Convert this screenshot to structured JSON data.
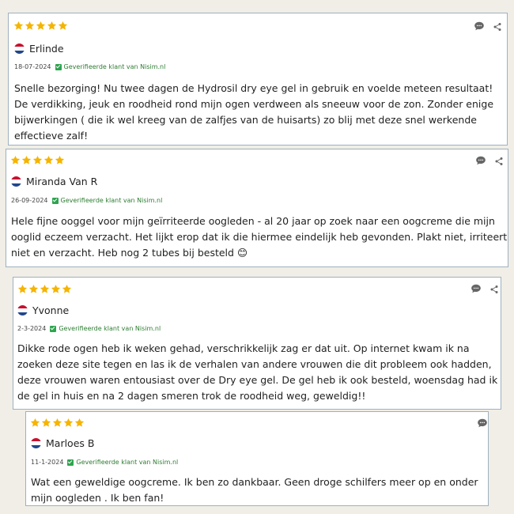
{
  "colors": {
    "star": "#f5b400",
    "verified": "#2ea44f",
    "border": "#9fb0c0",
    "background": "#f0eee6"
  },
  "reviews": [
    {
      "rating": 5,
      "name": "Erlinde",
      "date": "18-07-2024",
      "verified_label": "Geverifieerde klant van Nisim.nl",
      "text": "Snelle bezorging! Nu twee dagen de Hydrosil dry eye gel in gebruik en voelde meteen resultaat! De verdikking, jeuk en roodheid rond mijn ogen verdween als sneeuw voor de zon. Zonder enige bijwerkingen ( die ik wel kreeg van de zalfjes van de huisarts) zo blij met deze snel werkende effectieve zalf!"
    },
    {
      "rating": 5,
      "name": "Miranda Van R",
      "date": "26-09-2024",
      "verified_label": "Geverifieerde klant van Nisim.nl",
      "text": "Hele fijne ooggel voor mijn geïrriteerde oogleden - al 20 jaar op zoek naar een oogcreme die mijn ooglid eczeem verzacht. Het lijkt erop dat ik die hiermee eindelijk heb gevonden. Plakt niet, irriteert niet en verzacht. Heb nog 2 tubes bij besteld 😊"
    },
    {
      "rating": 5,
      "name": "Yvonne",
      "date": "2-3-2024",
      "verified_label": "Geverifieerde klant van Nisim.nl",
      "text": "Dikke rode ogen heb ik weken gehad, verschrikkelijk zag er dat uit. Op internet kwam ik na zoeken deze site tegen en las ik de verhalen van andere vrouwen die dit probleem ook hadden, deze vrouwen waren entousiast over de Dry eye gel. De gel heb ik ook besteld, woensdag had ik de gel in huis en na 2 dagen smeren trok de roodheid weg, geweldig!!"
    },
    {
      "rating": 5,
      "name": "Marloes B",
      "date": "11-1-2024",
      "verified_label": "Geverifieerde klant van Nisim.nl",
      "text": "Wat een geweldige oogcreme. Ik ben zo dankbaar. Geen droge schilfers meer op en onder mijn oogleden . Ik ben fan!"
    }
  ]
}
